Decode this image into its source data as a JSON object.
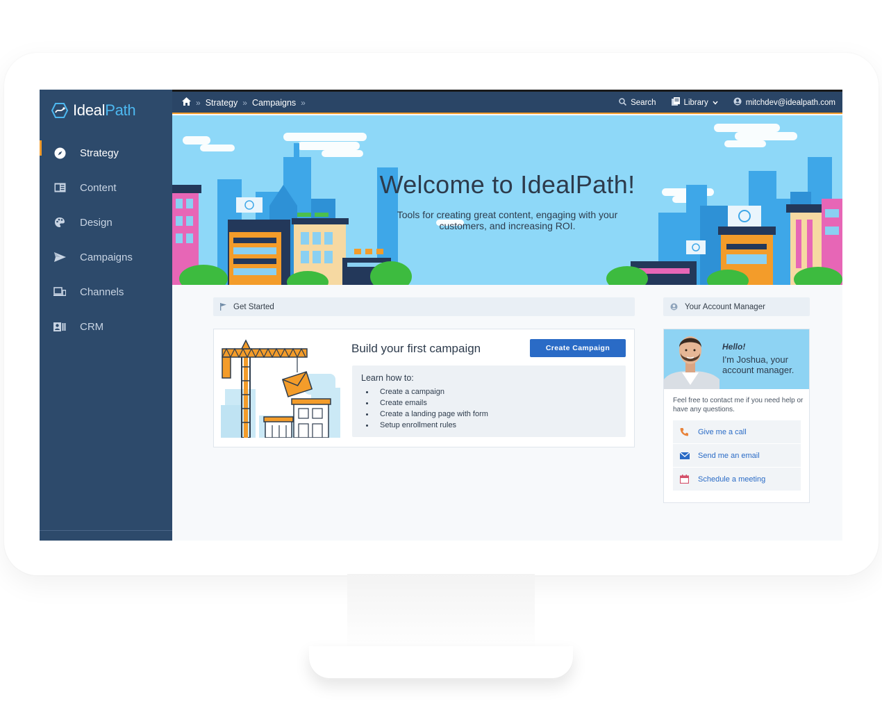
{
  "brand": {
    "name_main": "Ideal",
    "name_accent": "Path"
  },
  "sidebar": {
    "items": [
      {
        "label": "Strategy",
        "icon": "compass-icon",
        "active": true
      },
      {
        "label": "Content",
        "icon": "newspaper-icon",
        "active": false
      },
      {
        "label": "Design",
        "icon": "palette-icon",
        "active": false
      },
      {
        "label": "Campaigns",
        "icon": "paper-plane-icon",
        "active": false
      },
      {
        "label": "Channels",
        "icon": "devices-icon",
        "active": false
      },
      {
        "label": "CRM",
        "icon": "address-card-icon",
        "active": false
      }
    ]
  },
  "topbar": {
    "breadcrumb": [
      "Strategy",
      "Campaigns"
    ],
    "separator": "»",
    "search_label": "Search",
    "library_label": "Library",
    "user_email": "mitchdev@idealpath.com"
  },
  "banner": {
    "title": "Welcome to IdealPath!",
    "subtitle": "Tools for creating great content, engaging with your customers, and increasing ROI."
  },
  "get_started": {
    "header": "Get Started",
    "card_title": "Build your first campaign",
    "button_label": "Create Campaign",
    "learn_title": "Learn how to:",
    "learn_items": [
      "Create a campaign",
      "Create emails",
      "Create a landing page with form",
      "Setup enrollment rules"
    ]
  },
  "account_manager": {
    "header": "Your Account Manager",
    "hello": "Hello!",
    "intro": "I'm Joshua, your account manager.",
    "note": "Feel free to contact me if you need help or have any questions.",
    "actions": [
      {
        "label": "Give me a call",
        "icon": "phone-icon",
        "color": "#e8833a"
      },
      {
        "label": "Send me an email",
        "icon": "envelope-icon",
        "color": "#2a6bc6"
      },
      {
        "label": "Schedule a meeting",
        "icon": "calendar-icon",
        "color": "#d4506a"
      }
    ]
  },
  "colors": {
    "sidebar": "#2d4a6b",
    "topbar": "#2a4566",
    "accent": "#f39c2a",
    "primary": "#2a6bc6",
    "banner_sky": "#8ed8f8"
  }
}
